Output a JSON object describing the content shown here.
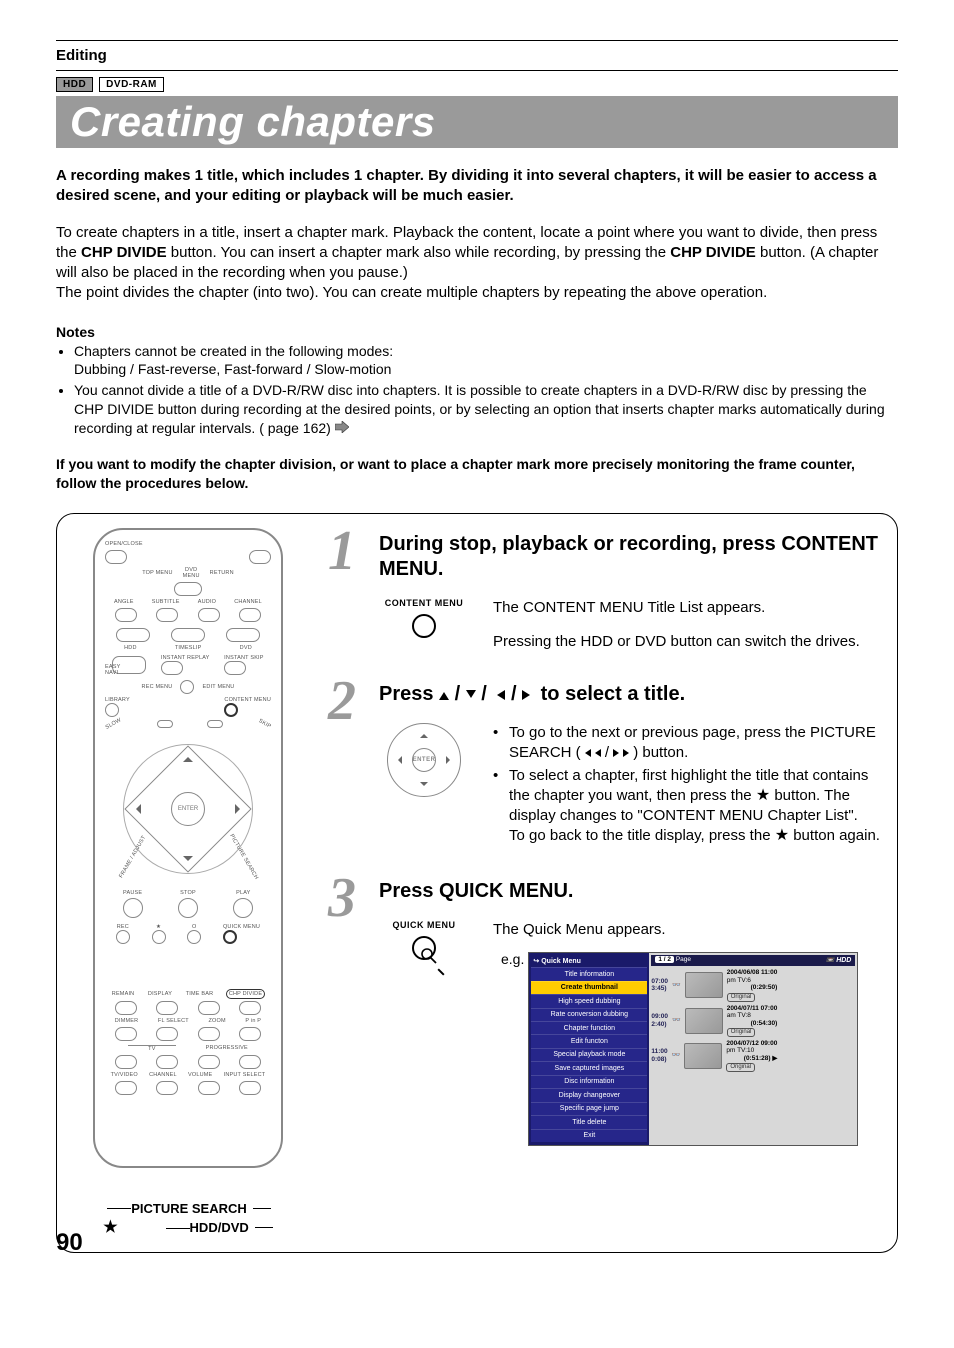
{
  "header": {
    "section": "Editing",
    "badges": [
      "HDD",
      "DVD-RAM"
    ],
    "title": "Creating chapters"
  },
  "lead": "A recording makes 1 title, which includes 1 chapter.  By dividing it into several chapters, it will be easier to access a desired scene, and your editing or playback will be much easier.",
  "body": {
    "para1_pre": "To create chapters in a title, insert a chapter mark. Playback the content, locate a point where you want to divide, then press the ",
    "chp1": "CHP DIVIDE",
    "para1_mid": " button. You can insert a chapter mark also while recording, by pressing the ",
    "chp2": "CHP DIVIDE",
    "para1_post": " button. (A chapter will also be placed in the recording when you pause.)",
    "para2": "The point divides the chapter (into two). You can create multiple chapters by repeating the above operation."
  },
  "notes": {
    "heading": "Notes",
    "items": [
      "Chapters cannot be created in the following modes:\nDubbing / Fast-reverse, Fast-forward / Slow-motion",
      "You cannot divide a title of a DVD-R/RW disc into chapters. It is possible to create chapters in a DVD-R/RW disc by pressing the CHP DIVIDE button during recording at the desired points, or by selecting an option that inserts chapter marks automatically during recording at regular intervals. (       page 162)"
    ]
  },
  "bold_intro": "If you want to modify the chapter division, or want to place a chapter mark more precisely monitoring the frame counter, follow the procedures below.",
  "remote": {
    "labels": {
      "openclose": "OPEN/CLOSE",
      "topmenu": "TOP MENU",
      "dvdmenu": "DVD\nMENU",
      "return": "RETURN",
      "angle": "ANGLE",
      "subtitle": "SUBTITLE",
      "audio": "AUDIO",
      "channel": "CHANNEL",
      "hdd": "HDD",
      "timeslip": "TIMESLIP",
      "dvd": "DVD",
      "easynavi": "EASY\nNAVI",
      "instrep": "INSTANT REPLAY",
      "instskip": "INSTANT SKIP",
      "recmenu": "REC MENU",
      "editmenu": "EDIT MENU",
      "library": "LIBRARY",
      "contentmenu": "CONTENT MENU",
      "slow": "SLOW",
      "skip": "SKIP",
      "enter": "ENTER",
      "frameadj": "FRAME / ADJUST",
      "picsearch": "PICTURE SEARCH",
      "pause": "PAUSE",
      "stop": "STOP",
      "play": "PLAY",
      "rec": "REC",
      "star": "★",
      "o": "O",
      "quickmenu": "QUICK MENU",
      "remain": "REMAIN",
      "display": "DISPLAY",
      "timebar": "TIME BAR",
      "chpdivide": "CHP DIVIDE",
      "dimmer": "DIMMER",
      "flselect": "FL SELECT",
      "zoom": "ZOOM",
      "pinp": "P in P",
      "tv": "TV",
      "progressive": "PROGRESSIVE",
      "tvvideo": "TV/VIDEO",
      "channel2": "CHANNEL",
      "volume": "VOLUME",
      "inputsel": "INPUT SELECT"
    },
    "callouts": {
      "picture_search": "PICTURE SEARCH",
      "hdd_dvd": "HDD/DVD"
    }
  },
  "steps": [
    {
      "num": "1",
      "title": "During stop, playback or recording, press CONTENT MENU.",
      "icon_label": "CONTENT MENU",
      "lines": [
        "The CONTENT MENU Title List appears.",
        "Pressing the HDD or DVD button can switch the drives."
      ]
    },
    {
      "num": "2",
      "title_prefix": "Press ",
      "title_suffix": " to select a title.",
      "bullets": [
        {
          "pre": "To go to the next or previous page, press the PICTURE SEARCH (",
          "mid": " / ",
          "post": ") button."
        },
        {
          "pre": "To select a chapter, first highlight the title that contains the chapter you want, then press the ",
          "post_a": " button. The display changes to \"CONTENT MENU Chapter List\"."
        },
        {
          "pre2": "To go back to the title display, press the ",
          "post2": " button again."
        }
      ]
    },
    {
      "num": "3",
      "title": "Press QUICK MENU.",
      "icon_label": "QUICK MENU",
      "line": "The Quick Menu appears.",
      "eg": "e.g."
    }
  ],
  "quick_menu_panel": {
    "header_icon": "↪",
    "header": "Quick Menu",
    "items": [
      "Title information",
      "Create thumbnail",
      "High speed dubbing",
      "Rate conversion dubbing",
      "Chapter function",
      "Edit functon",
      "Special playback mode",
      "Save captured images",
      "Disc information",
      "Display changeover",
      "Specific page jump",
      "Title delete",
      "Exit"
    ],
    "highlight_index": 1,
    "top_bar": {
      "page": "1 / 2",
      "page_label": "Page",
      "drive": "HDD"
    },
    "cards": [
      {
        "time": "07:00",
        "len": "3:45)",
        "date": "2004/06/08 11:00",
        "ch": "pm  TV:6",
        "dur": "(0:29:50)",
        "tag": "Original"
      },
      {
        "time": "09:00",
        "len": "2:40)",
        "date": "2004/07/11 07:00",
        "ch": "am  TV:8",
        "dur": "(0:54:30)",
        "tag": "Original"
      },
      {
        "time": "11:00",
        "len": "0:08)",
        "date": "2004/07/12 09:00",
        "ch": "pm  TV:10",
        "dur": "(0:51:28)",
        "tag": "Original",
        "arrow": "▶"
      }
    ]
  },
  "page_number": "90"
}
